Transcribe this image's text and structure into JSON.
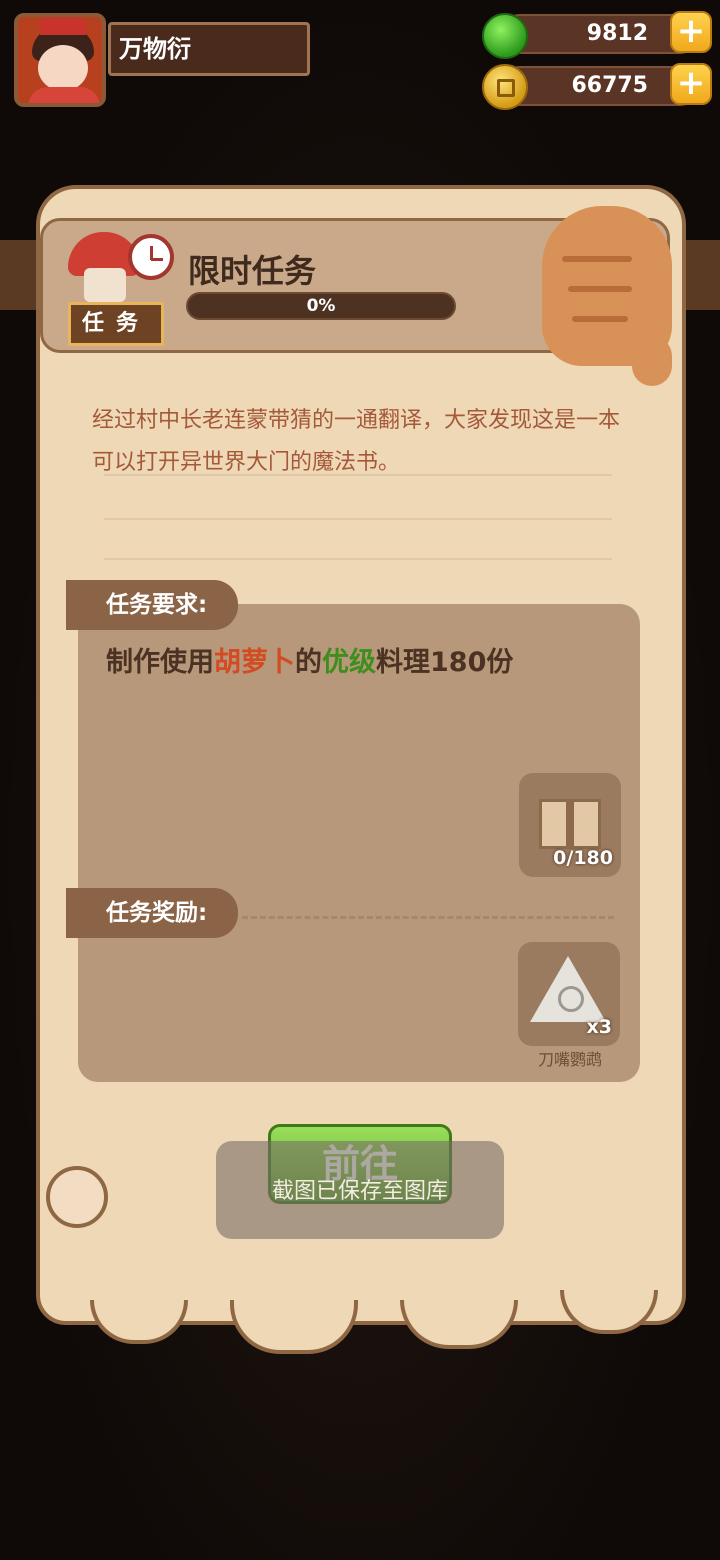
{
  "player": {
    "name": "万物衍"
  },
  "currency": {
    "gems": "9812",
    "coins": "66775",
    "add_label": "+"
  },
  "task": {
    "badge": "任务",
    "title": "限时任务",
    "progress_text": "0%",
    "progress_fraction": 0,
    "description": "经过村中长老连蒙带猜的一通翻译，大家发现这是一本可以打开异世界大门的魔法书。",
    "requirement_label": "任务要求:",
    "requirement": {
      "prefix": "制作使用",
      "ingredient": "胡萝卜",
      "mid": "的",
      "grade": "优级",
      "suffix": "料理180份"
    },
    "requirement_item_count": "0/180",
    "reward_label": "任务奖励:",
    "reward_count": "x3",
    "reward_name": "刀嘴鹦鹉",
    "go_button": "前往"
  },
  "toast": "截图已保存至图库",
  "colors": {
    "ingredient": "#d24b22",
    "grade": "#3e8e1e",
    "go_button": "#6db83a"
  }
}
